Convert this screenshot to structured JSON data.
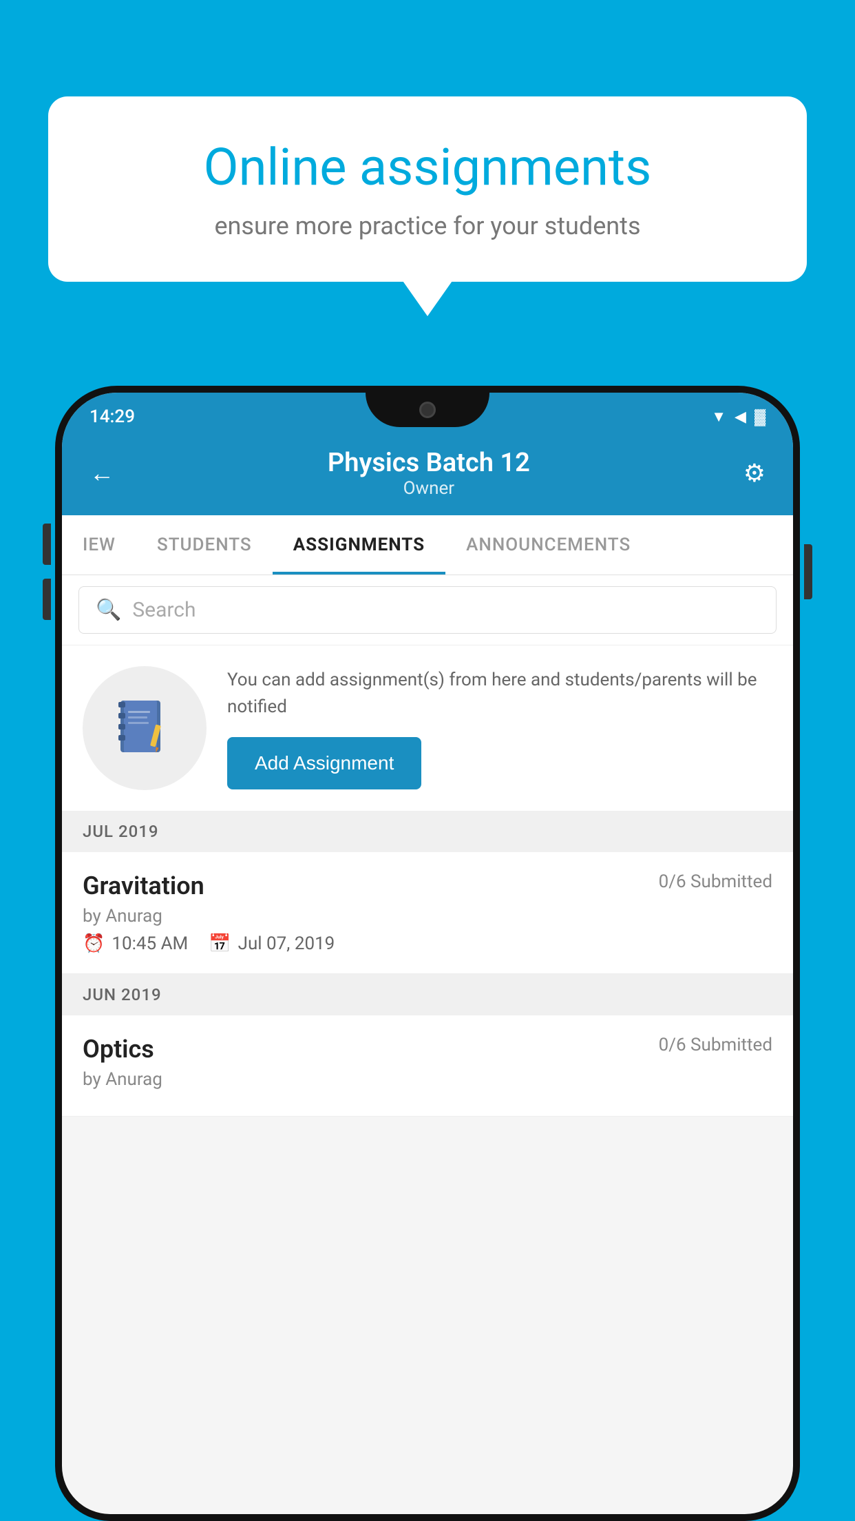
{
  "background_color": "#00AADD",
  "speech_bubble": {
    "title": "Online assignments",
    "subtitle": "ensure more practice for your students"
  },
  "status_bar": {
    "time": "14:29",
    "wifi": "▲",
    "signal": "▲",
    "battery": "▓"
  },
  "header": {
    "title": "Physics Batch 12",
    "subtitle": "Owner",
    "back_label": "←",
    "settings_label": "⚙"
  },
  "tabs": [
    {
      "label": "IEW",
      "active": false
    },
    {
      "label": "STUDENTS",
      "active": false
    },
    {
      "label": "ASSIGNMENTS",
      "active": true
    },
    {
      "label": "ANNOUNCEMENTS",
      "active": false
    }
  ],
  "search": {
    "placeholder": "Search"
  },
  "promo": {
    "description": "You can add assignment(s) from here and students/parents will be notified",
    "button_label": "Add Assignment"
  },
  "assignments": [
    {
      "month": "JUL 2019",
      "items": [
        {
          "title": "Gravitation",
          "submitted": "0/6 Submitted",
          "by": "by Anurag",
          "time": "10:45 AM",
          "date": "Jul 07, 2019"
        }
      ]
    },
    {
      "month": "JUN 2019",
      "items": [
        {
          "title": "Optics",
          "submitted": "0/6 Submitted",
          "by": "by Anurag",
          "time": "",
          "date": ""
        }
      ]
    }
  ]
}
